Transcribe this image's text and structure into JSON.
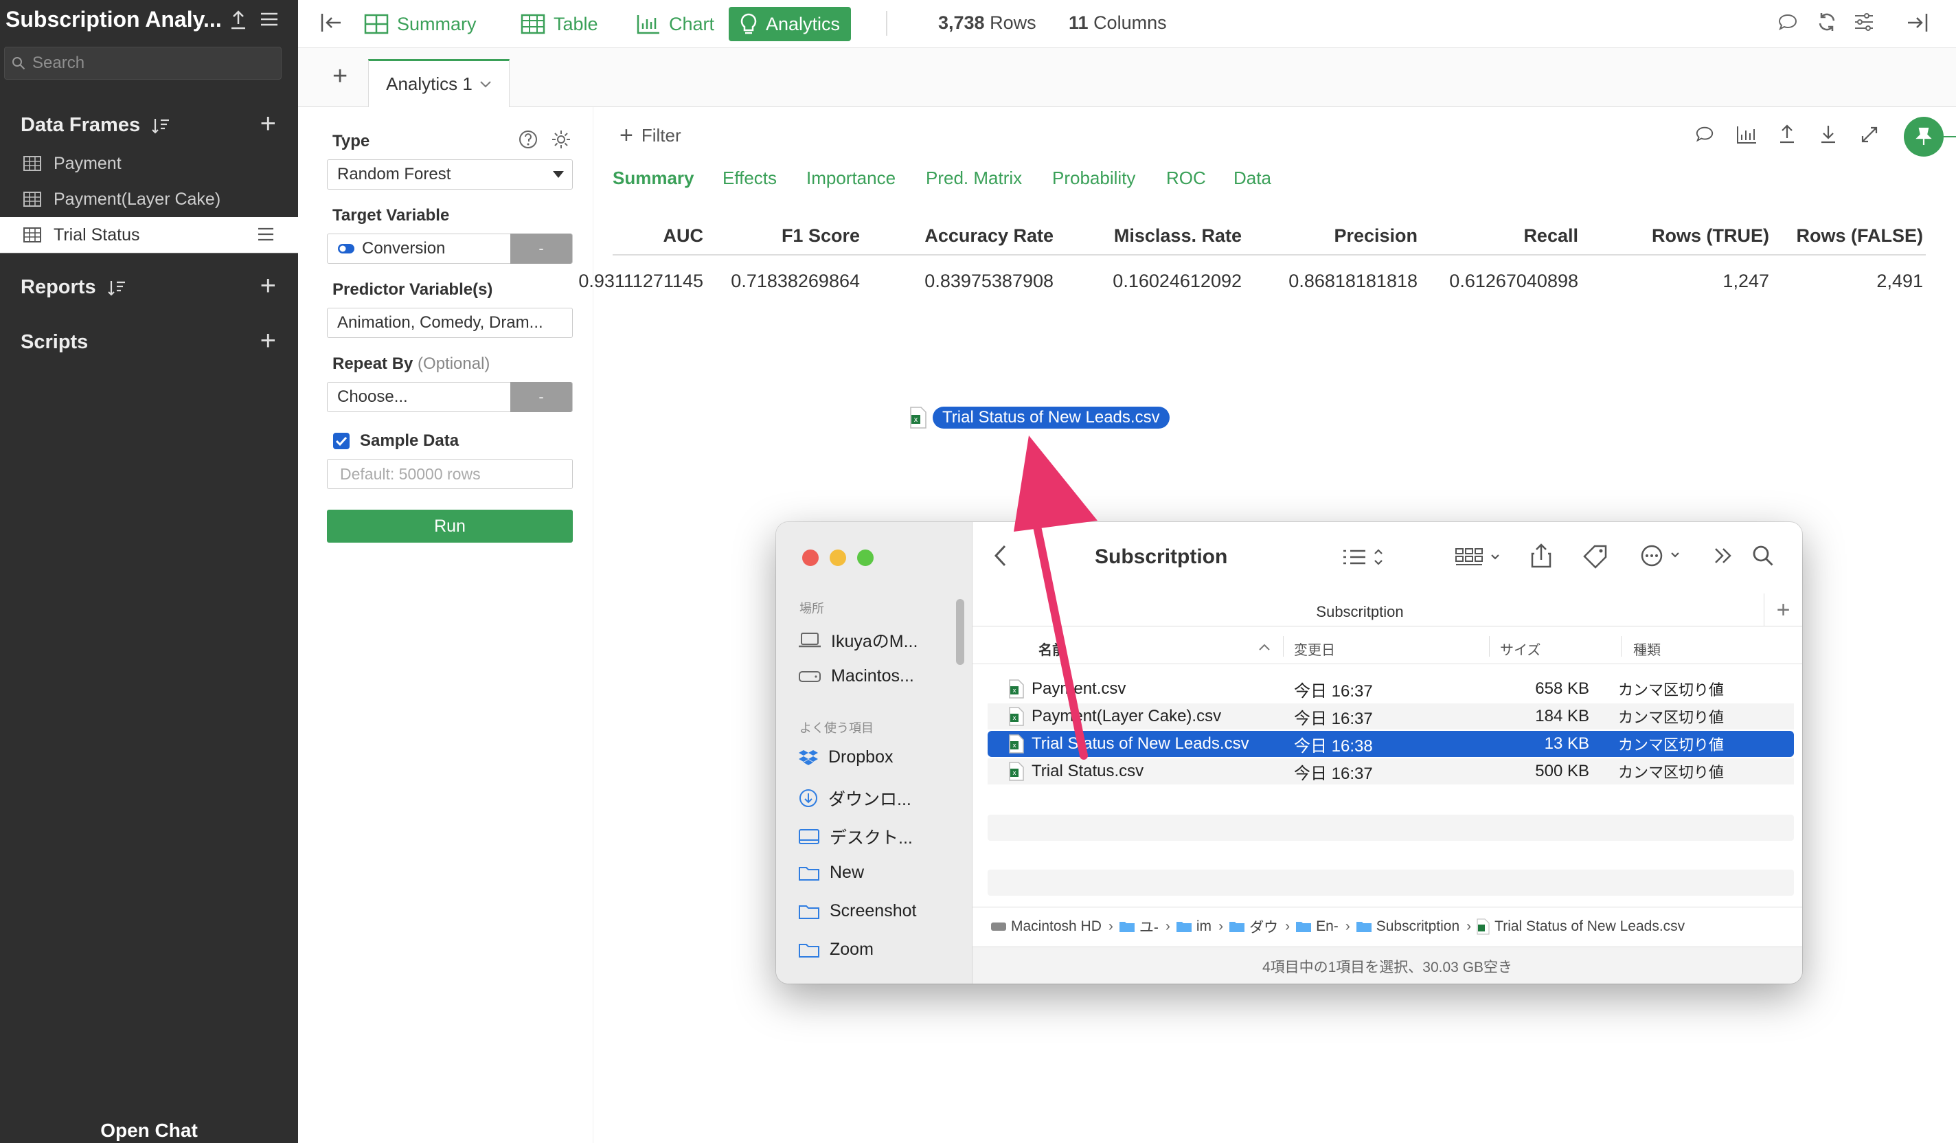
{
  "colors": {
    "accent": "#3aa058",
    "sidebar_bg": "#2f2f2f",
    "selection": "#1e62d0",
    "arrow": "#e8346a"
  },
  "sidebar": {
    "title": "Subscription Analy...",
    "search_placeholder": "Search",
    "data_frames_label": "Data Frames",
    "data_frames": [
      {
        "label": "Payment"
      },
      {
        "label": "Payment(Layer Cake)"
      },
      {
        "label": "Trial Status",
        "active": true
      }
    ],
    "reports_label": "Reports",
    "scripts_label": "Scripts",
    "open_chat": "Open Chat"
  },
  "topbar": {
    "tabs": [
      {
        "label": "Summary",
        "icon": "summary-icon"
      },
      {
        "label": "Table",
        "icon": "table-icon"
      },
      {
        "label": "Chart",
        "icon": "chart-icon"
      },
      {
        "label": "Analytics",
        "icon": "bulb-icon",
        "active": true
      }
    ],
    "rows_count": "3,738",
    "rows_label": "Rows",
    "columns_count": "11",
    "columns_label": "Columns"
  },
  "subtabs": {
    "analytics_tab": "Analytics 1"
  },
  "panel": {
    "type_label": "Type",
    "type_value": "Random Forest",
    "target_label": "Target Variable",
    "target_value": "Conversion",
    "target_btn": "-",
    "predictor_label": "Predictor Variable(s)",
    "predictor_value": "Animation, Comedy, Dram...",
    "repeat_label": "Repeat By",
    "repeat_optional": "(Optional)",
    "repeat_value": "Choose...",
    "repeat_btn": "-",
    "sample_label": "Sample Data",
    "sample_placeholder": "Default: 50000 rows",
    "run_label": "Run"
  },
  "main": {
    "filter_label": "Filter",
    "result_tabs": [
      "Summary",
      "Effects",
      "Importance",
      "Pred. Matrix",
      "Probability",
      "ROC",
      "Data"
    ],
    "table": {
      "headers": [
        "AUC",
        "F1 Score",
        "Accuracy Rate",
        "Misclass. Rate",
        "Precision",
        "Recall",
        "Rows (TRUE)",
        "Rows (FALSE)"
      ],
      "row": [
        "0.93111271145",
        "0.71838269864",
        "0.83975387908",
        "0.16024612092",
        "0.86818181818",
        "0.61267040898",
        "1,247",
        "2,491"
      ]
    }
  },
  "drag": {
    "label": "Trial Status of New Leads.csv"
  },
  "finder": {
    "title": "Subscritption",
    "path_header": "Subscritption",
    "sidebar_header_places": "場所",
    "places": [
      "IkuyaのM...",
      "Macintos..."
    ],
    "sidebar_header_favorites": "よく使う項目",
    "favorites": [
      "Dropbox",
      "ダウンロ...",
      "デスクト...",
      "New",
      "Screenshot",
      "Zoom"
    ],
    "columns": [
      "名前",
      "変更日",
      "サイズ",
      "種類"
    ],
    "files": [
      {
        "name": "Payment.csv",
        "date": "今日 16:37",
        "size": "658 KB",
        "kind": "カンマ区切り値"
      },
      {
        "name": "Payment(Layer Cake).csv",
        "date": "今日 16:37",
        "size": "184 KB",
        "kind": "カンマ区切り値"
      },
      {
        "name": "Trial Status of New Leads.csv",
        "date": "今日 16:38",
        "size": "13 KB",
        "kind": "カンマ区切り値",
        "selected": true
      },
      {
        "name": "Trial Status.csv",
        "date": "今日 16:37",
        "size": "500 KB",
        "kind": "カンマ区切り値"
      }
    ],
    "breadcrumb": [
      "Macintosh HD",
      "ユ-",
      "im",
      "ダウ",
      "En-",
      "Subscritption",
      "Trial Status of New Leads.csv"
    ],
    "status": "4項目中の1項目を選択、30.03 GB空き"
  }
}
